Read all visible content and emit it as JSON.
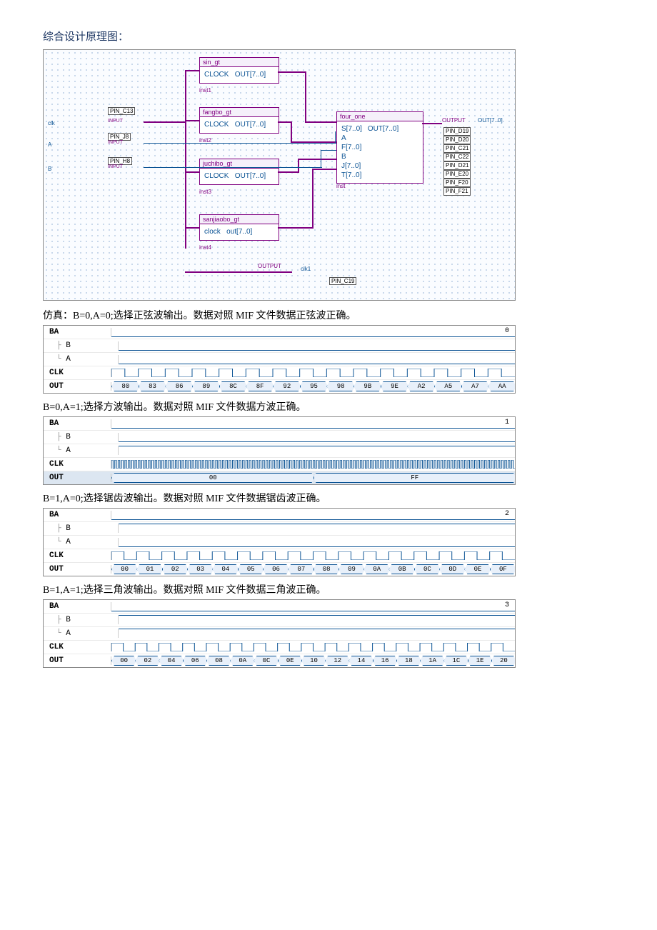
{
  "heading": "综合设计原理图：",
  "schematic": {
    "blocks": {
      "sin": {
        "title": "sin_gt",
        "in": "CLOCK",
        "out": "OUT[7..0]",
        "inst": "inst1"
      },
      "fang": {
        "title": "fangbo_gt",
        "in": "CLOCK",
        "out": "OUT[7..0]",
        "inst": "inst2"
      },
      "ju": {
        "title": "juchibo_gt",
        "in": "CLOCK",
        "out": "OUT[7..0]",
        "inst": "inst3"
      },
      "san": {
        "title": "sanjiaobo_gt",
        "in": "clock",
        "out": "out[7..0]",
        "inst": "inst4"
      },
      "mux": {
        "title": "four_one",
        "ports": [
          "S[7..0]",
          "A",
          "F[7..0]",
          "B",
          "J[7..0]",
          "T[7..0]"
        ],
        "out": "OUT[7..0]",
        "inst": "inst"
      }
    },
    "clk_port": "clk",
    "clk_pin": "PIN_C13",
    "a_pin": "PIN_J8",
    "b_pin": "PIN_H8",
    "a_lbl": "A",
    "b_lbl": "B",
    "input_lbl": "INPUT",
    "out_lbl": "OUTPUT",
    "out_bus": "OUT[7..0]",
    "out_pins": [
      "PIN_D19",
      "PIN_D20",
      "PIN_C21",
      "PIN_C22",
      "PIN_D21",
      "PIN_E20",
      "PIN_F20",
      "PIN_F21"
    ],
    "clk_out": "clk1",
    "clk_out_pin": "PIN_C19"
  },
  "sim1": {
    "caption": "仿真：B=0,A=0;选择正弦波输出。数据对照 MIF 文件数据正弦波正确。",
    "ba": "0",
    "out": [
      "80",
      "83",
      "86",
      "89",
      "8C",
      "8F",
      "92",
      "95",
      "98",
      "9B",
      "9E",
      "A2",
      "A5",
      "A7",
      "AA"
    ]
  },
  "sim2": {
    "caption": "B=0,A=1;选择方波输出。数据对照 MIF 文件数据方波正确。",
    "ba": "1",
    "out_segs": [
      {
        "label": "00",
        "w": 45
      },
      {
        "label": "FF",
        "w": 45
      }
    ]
  },
  "sim3": {
    "caption": "B=1,A=0;选择锯齿波输出。数据对照 MIF 文件数据锯齿波正确。",
    "ba": "2",
    "out": [
      "00",
      "01",
      "02",
      "03",
      "04",
      "05",
      "06",
      "07",
      "08",
      "09",
      "0A",
      "0B",
      "0C",
      "0D",
      "0E",
      "0F"
    ]
  },
  "sim4": {
    "caption": "B=1,A=1;选择三角波输出。数据对照 MIF 文件数据三角波正确。",
    "ba": "3",
    "out": [
      "00",
      "02",
      "04",
      "06",
      "08",
      "0A",
      "0C",
      "0E",
      "10",
      "12",
      "14",
      "16",
      "18",
      "1A",
      "1C",
      "1E",
      "20"
    ]
  },
  "labels": {
    "BA": "BA",
    "B": "B",
    "A": "A",
    "CLK": "CLK",
    "OUT": "OUT"
  }
}
